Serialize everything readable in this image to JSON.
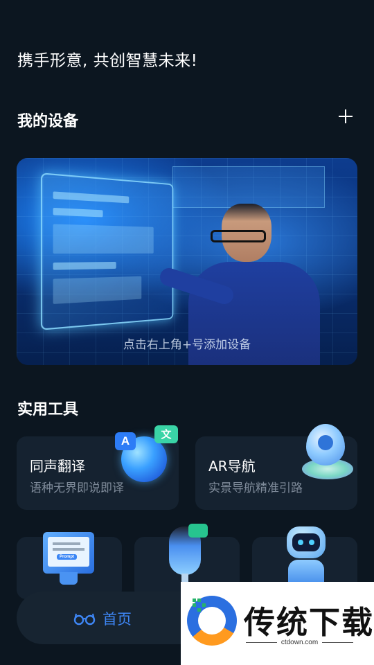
{
  "header": {
    "greeting": "携手形意, 共创智慧未来!"
  },
  "devices": {
    "title": "我的设备",
    "add_icon": "plus-icon",
    "banner_hint": "点击右上角+号添加设备"
  },
  "tools": {
    "title": "实用工具",
    "cards": [
      {
        "title": "同声翻译",
        "subtitle": "语种无界即说即译",
        "icon": "translate-globe-icon",
        "badges": [
          "A",
          "文"
        ]
      },
      {
        "title": "AR导航",
        "subtitle": "实景导航精准引路",
        "icon": "location-pin-icon"
      }
    ],
    "mini_cards": [
      {
        "icon": "prompt-monitor-icon",
        "screen_label": "Prompt"
      },
      {
        "icon": "microphone-icon"
      },
      {
        "icon": "robot-icon"
      }
    ]
  },
  "tabbar": {
    "home_label": "首页",
    "home_icon": "glasses-icon",
    "accent_color": "#3e86f5"
  },
  "watermark": {
    "brand": "传统下载",
    "url": "ctdown.com"
  }
}
